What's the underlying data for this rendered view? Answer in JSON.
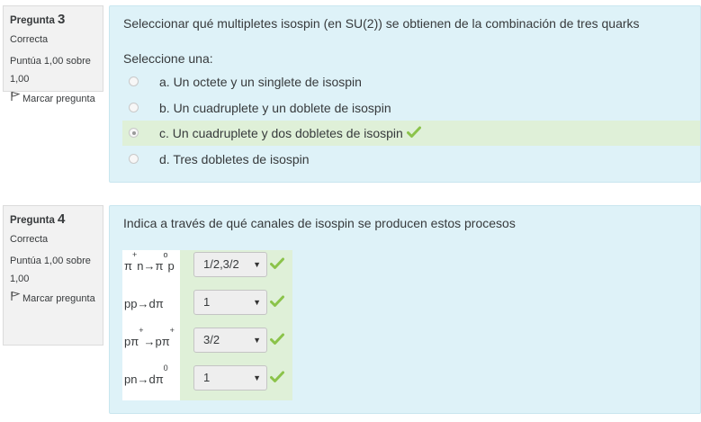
{
  "q3": {
    "label": "Pregunta",
    "number": "3",
    "state": "Correcta",
    "grade": "Puntúa 1,00 sobre 1,00",
    "flag": "Marcar pregunta",
    "text": "Seleccionar qué multipletes isospin (en SU(2)) se obtienen de la combinación de tres quarks",
    "prompt": "Seleccione una:",
    "options": [
      {
        "label": "a. Un octete y un singlete de isospin",
        "selected": false
      },
      {
        "label": "b. Un cuadruplete y un doblete de  isospin",
        "selected": false
      },
      {
        "label": "c. Un cuadruplete y dos dobletes de isospin",
        "selected": true
      },
      {
        "label": "d. Tres dobletes de isospin",
        "selected": false
      }
    ]
  },
  "q4": {
    "label": "Pregunta",
    "number": "4",
    "state": "Correcta",
    "grade": "Puntúa 1,00 sobre 1,00",
    "flag": "Marcar pregunta",
    "text": "Indica a través de qué canales de isospin se producen estos procesos",
    "rows": [
      {
        "process": {
          "a": "π",
          "a_sup": "+",
          "b": "n→π",
          "b_sup": "o",
          "c": "p"
        },
        "answer": "1/2,3/2"
      },
      {
        "process": {
          "a": "pp→dπ",
          "a_sup": "",
          "b": "",
          "b_sup": "",
          "c": ""
        },
        "answer": "1"
      },
      {
        "process": {
          "a": "pπ",
          "a_sup": "+",
          "b": "→pπ",
          "b_sup": "+",
          "c": ""
        },
        "answer": "3/2"
      },
      {
        "process": {
          "a": "pn→dπ",
          "a_sup": "0",
          "b": "",
          "b_sup": "",
          "c": ""
        },
        "answer": "1"
      }
    ]
  },
  "colors": {
    "info_bg": "#f2f2f2",
    "content_bg": "#def2f8",
    "correct_bg": "#dff0d8",
    "check_green": "#8bc34a"
  },
  "icons": {
    "flag": "flag-icon",
    "check": "check-icon",
    "caret": "caret-down-icon"
  }
}
